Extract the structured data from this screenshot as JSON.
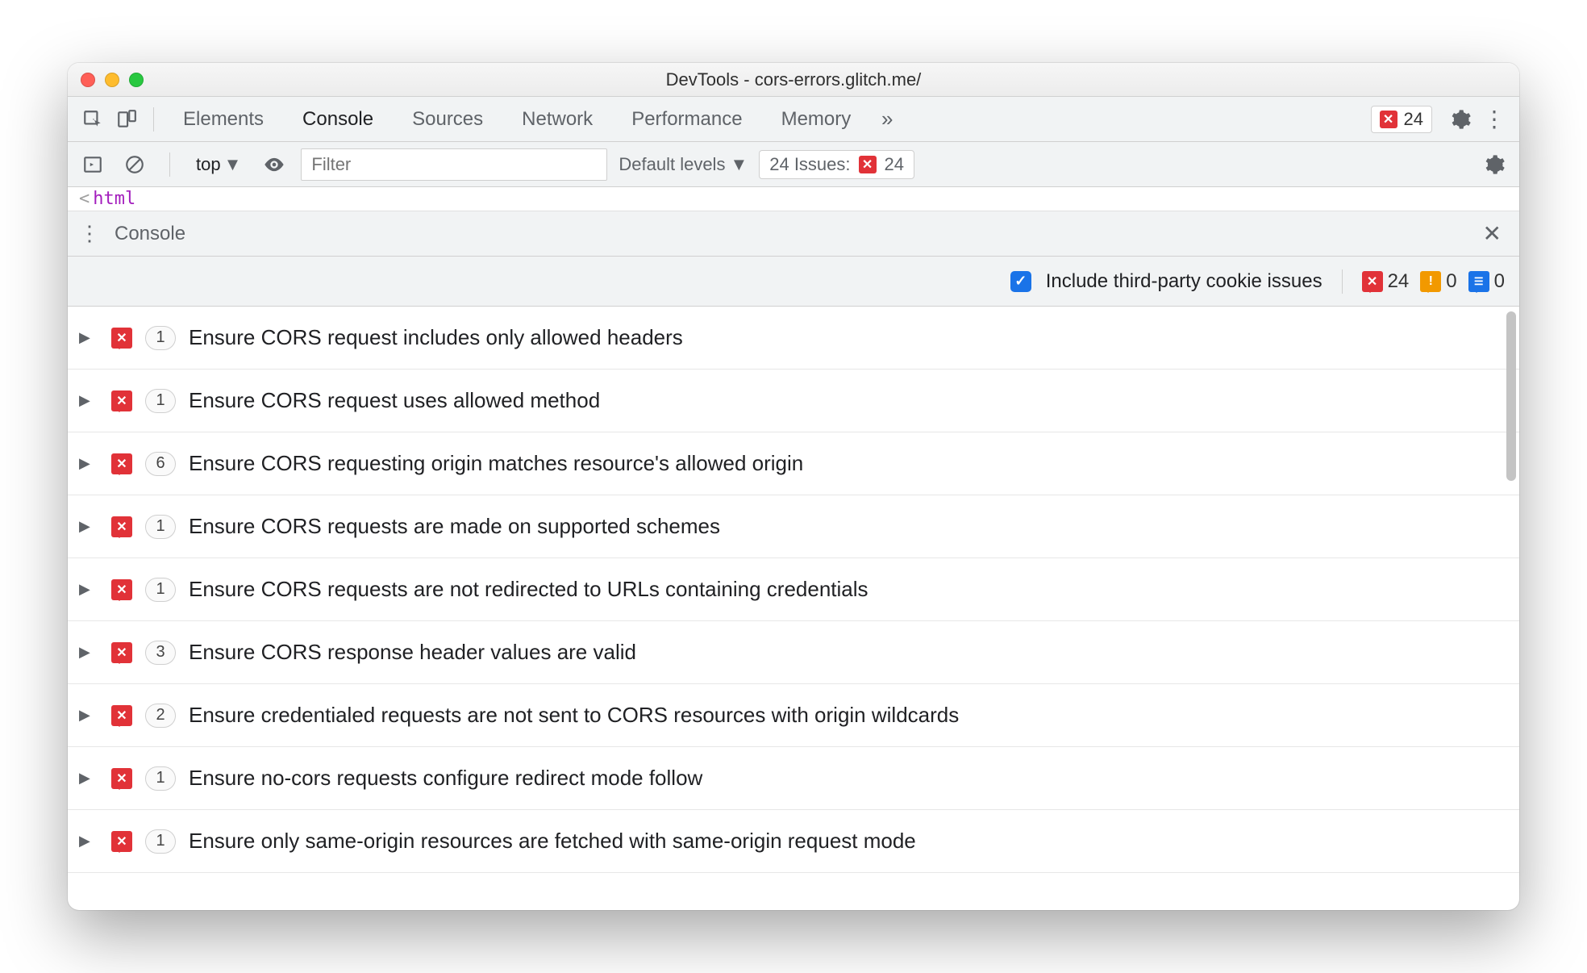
{
  "window": {
    "title": "DevTools - cors-errors.glitch.me/"
  },
  "tabs": {
    "items": [
      "Elements",
      "Console",
      "Sources",
      "Network",
      "Performance",
      "Memory"
    ],
    "active": "Console",
    "error_count": "24"
  },
  "filterbar": {
    "context": "top",
    "filter_placeholder": "Filter",
    "levels_label": "Default levels",
    "issues_label": "24 Issues:",
    "issues_count": "24"
  },
  "codepeek": {
    "lt": "<",
    "tag": "html"
  },
  "drawer": {
    "title": "Console"
  },
  "issues_subhead": {
    "checkbox_label": "Include third-party cookie issues",
    "errors": "24",
    "warnings": "0",
    "info": "0"
  },
  "issues": [
    {
      "count": "1",
      "text": "Ensure CORS request includes only allowed headers"
    },
    {
      "count": "1",
      "text": "Ensure CORS request uses allowed method"
    },
    {
      "count": "6",
      "text": "Ensure CORS requesting origin matches resource's allowed origin"
    },
    {
      "count": "1",
      "text": "Ensure CORS requests are made on supported schemes"
    },
    {
      "count": "1",
      "text": "Ensure CORS requests are not redirected to URLs containing credentials"
    },
    {
      "count": "3",
      "text": "Ensure CORS response header values are valid"
    },
    {
      "count": "2",
      "text": "Ensure credentialed requests are not sent to CORS resources with origin wildcards"
    },
    {
      "count": "1",
      "text": "Ensure no-cors requests configure redirect mode follow"
    },
    {
      "count": "1",
      "text": "Ensure only same-origin resources are fetched with same-origin request mode"
    }
  ]
}
